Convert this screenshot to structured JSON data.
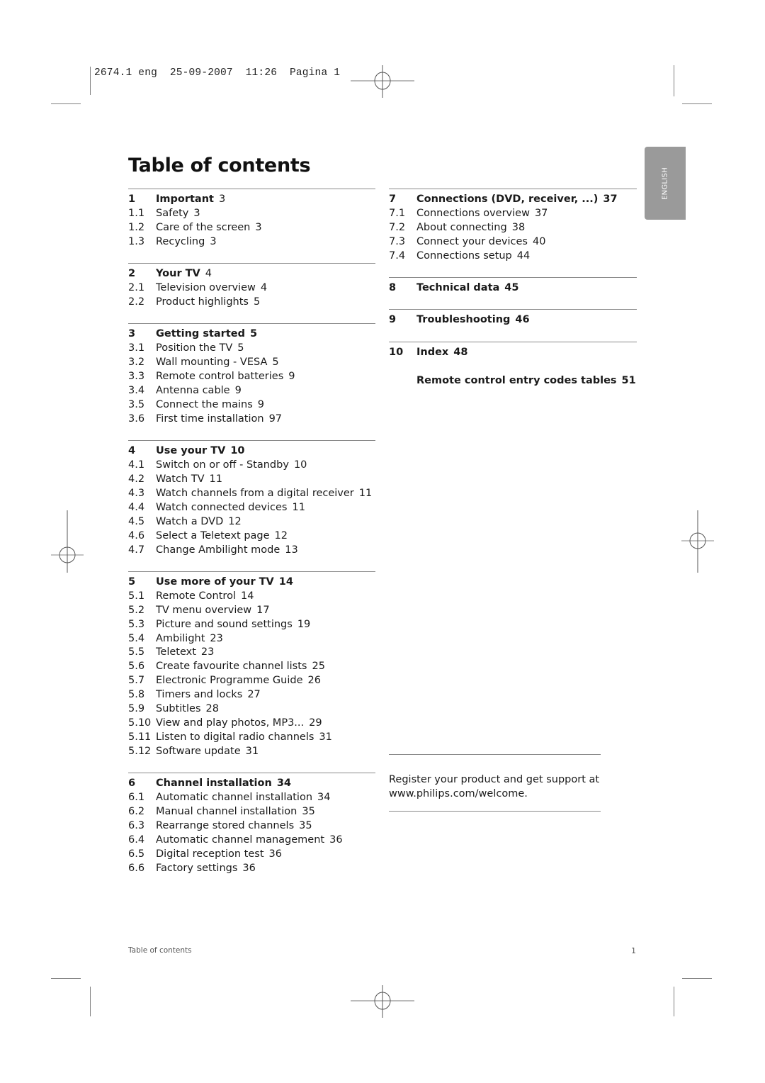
{
  "slug": {
    "text": "2674.1 eng  25-09-2007  11:26  Pagina 1"
  },
  "page_title": "Table of contents",
  "language_tab": "ENGLISH",
  "left_column": [
    {
      "number": "1",
      "title": "Important",
      "page": "3",
      "page_bold": false,
      "items": [
        {
          "number": "1.1",
          "title": "Safety",
          "page": "3"
        },
        {
          "number": "1.2",
          "title": "Care of the screen",
          "page": "3"
        },
        {
          "number": "1.3",
          "title": "Recycling ",
          "page": "3"
        }
      ]
    },
    {
      "number": "2",
      "title": "Your TV",
      "page": "4",
      "page_bold": false,
      "items": [
        {
          "number": "2.1",
          "title": "Television overview",
          "page": "4"
        },
        {
          "number": "2.2",
          "title": "Product highlights",
          "page": "5"
        }
      ]
    },
    {
      "number": "3",
      "title": "Getting started",
      "page": "5",
      "page_bold": true,
      "items": [
        {
          "number": "3.1",
          "title": "Position the TV",
          "page": "5"
        },
        {
          "number": "3.2",
          "title": "Wall mounting - VESA",
          "page": "5"
        },
        {
          "number": "3.3",
          "title": "Remote control batteries",
          "page": "9"
        },
        {
          "number": "3.4",
          "title": "Antenna cable",
          "page": "9"
        },
        {
          "number": "3.5",
          "title": "Connect the mains",
          "page": "9"
        },
        {
          "number": "3.6",
          "title": "First time installation",
          "page": "97"
        }
      ]
    },
    {
      "number": "4",
      "title": "Use your TV",
      "page": "10",
      "page_bold": true,
      "items": [
        {
          "number": "4.1",
          "title": "Switch on or off - Standby",
          "page": "10"
        },
        {
          "number": "4.2",
          "title": "Watch TV",
          "page": "11"
        },
        {
          "number": "4.3",
          "title": "Watch channels from a digital receiver",
          "page": "11"
        },
        {
          "number": "4.4",
          "title": "Watch connected devices",
          "page": "11"
        },
        {
          "number": "4.5",
          "title": "Watch a DVD",
          "page": "12"
        },
        {
          "number": "4.6",
          "title": "Select a Teletext page",
          "page": "12"
        },
        {
          "number": "4.7",
          "title": "Change Ambilight mode",
          "page": "13"
        }
      ]
    },
    {
      "number": "5",
      "title": "Use more of your TV",
      "page": "14",
      "page_bold": true,
      "items": [
        {
          "number": "5.1",
          "title": "Remote Control",
          "page": "14"
        },
        {
          "number": "5.2",
          "title": "TV menu overview",
          "page": "17"
        },
        {
          "number": "5.3",
          "title": "Picture and sound settings",
          "page": "19"
        },
        {
          "number": "5.4",
          "title": "Ambilight",
          "page": "23"
        },
        {
          "number": "5.5",
          "title": "Teletext",
          "page": "23"
        },
        {
          "number": "5.6",
          "title": "Create favourite channel lists",
          "page": "25"
        },
        {
          "number": "5.7",
          "title": "Electronic Programme Guide",
          "page": "26"
        },
        {
          "number": "5.8",
          "title": "Timers and locks",
          "page": "27"
        },
        {
          "number": "5.9",
          "title": "Subtitles",
          "page": "28"
        },
        {
          "number": "5.10",
          "title": "View and play photos, MP3...",
          "page": "29"
        },
        {
          "number": "5.11",
          "title": "Listen to digital radio channels",
          "page": "31"
        },
        {
          "number": "5.12",
          "title": "Software update",
          "page": "31"
        }
      ]
    },
    {
      "number": "6",
      "title": "Channel installation",
      "page": "34",
      "page_bold": true,
      "items": [
        {
          "number": "6.1",
          "title": "Automatic channel installation",
          "page": "34"
        },
        {
          "number": "6.2",
          "title": "Manual channel installation",
          "page": "35"
        },
        {
          "number": "6.3",
          "title": "Rearrange stored channels",
          "page": "35"
        },
        {
          "number": "6.4",
          "title": "Automatic channel management",
          "page": "36"
        },
        {
          "number": "6.5",
          "title": "Digital reception test",
          "page": "36"
        },
        {
          "number": "6.6",
          "title": "Factory settings",
          "page": "36"
        }
      ]
    }
  ],
  "right_column": [
    {
      "number": "7",
      "title": "Connections (DVD, receiver, ...)",
      "page": "37",
      "page_bold": true,
      "items": [
        {
          "number": "7.1",
          "title": "Connections overview",
          "page": "37"
        },
        {
          "number": "7.2",
          "title": "About connecting",
          "page": "38"
        },
        {
          "number": "7.3",
          "title": "Connect your devices",
          "page": "40"
        },
        {
          "number": "7.4",
          "title": "Connections setup",
          "page": "44"
        }
      ]
    },
    {
      "number": "8",
      "title": "Technical data",
      "page": "45",
      "page_bold": true,
      "items": []
    },
    {
      "number": "9",
      "title": "Troubleshooting",
      "page": "46",
      "page_bold": true,
      "items": []
    },
    {
      "number": "10",
      "title": "Index",
      "page": "48",
      "page_bold": true,
      "items": []
    }
  ],
  "extra_entry": {
    "title": "Remote control entry codes tables",
    "page": "51"
  },
  "register_note": {
    "line1": "Register your product and get support at",
    "line2": "www.philips.com/welcome."
  },
  "footer": {
    "section_name": "Table of contents",
    "page_number": "1"
  }
}
